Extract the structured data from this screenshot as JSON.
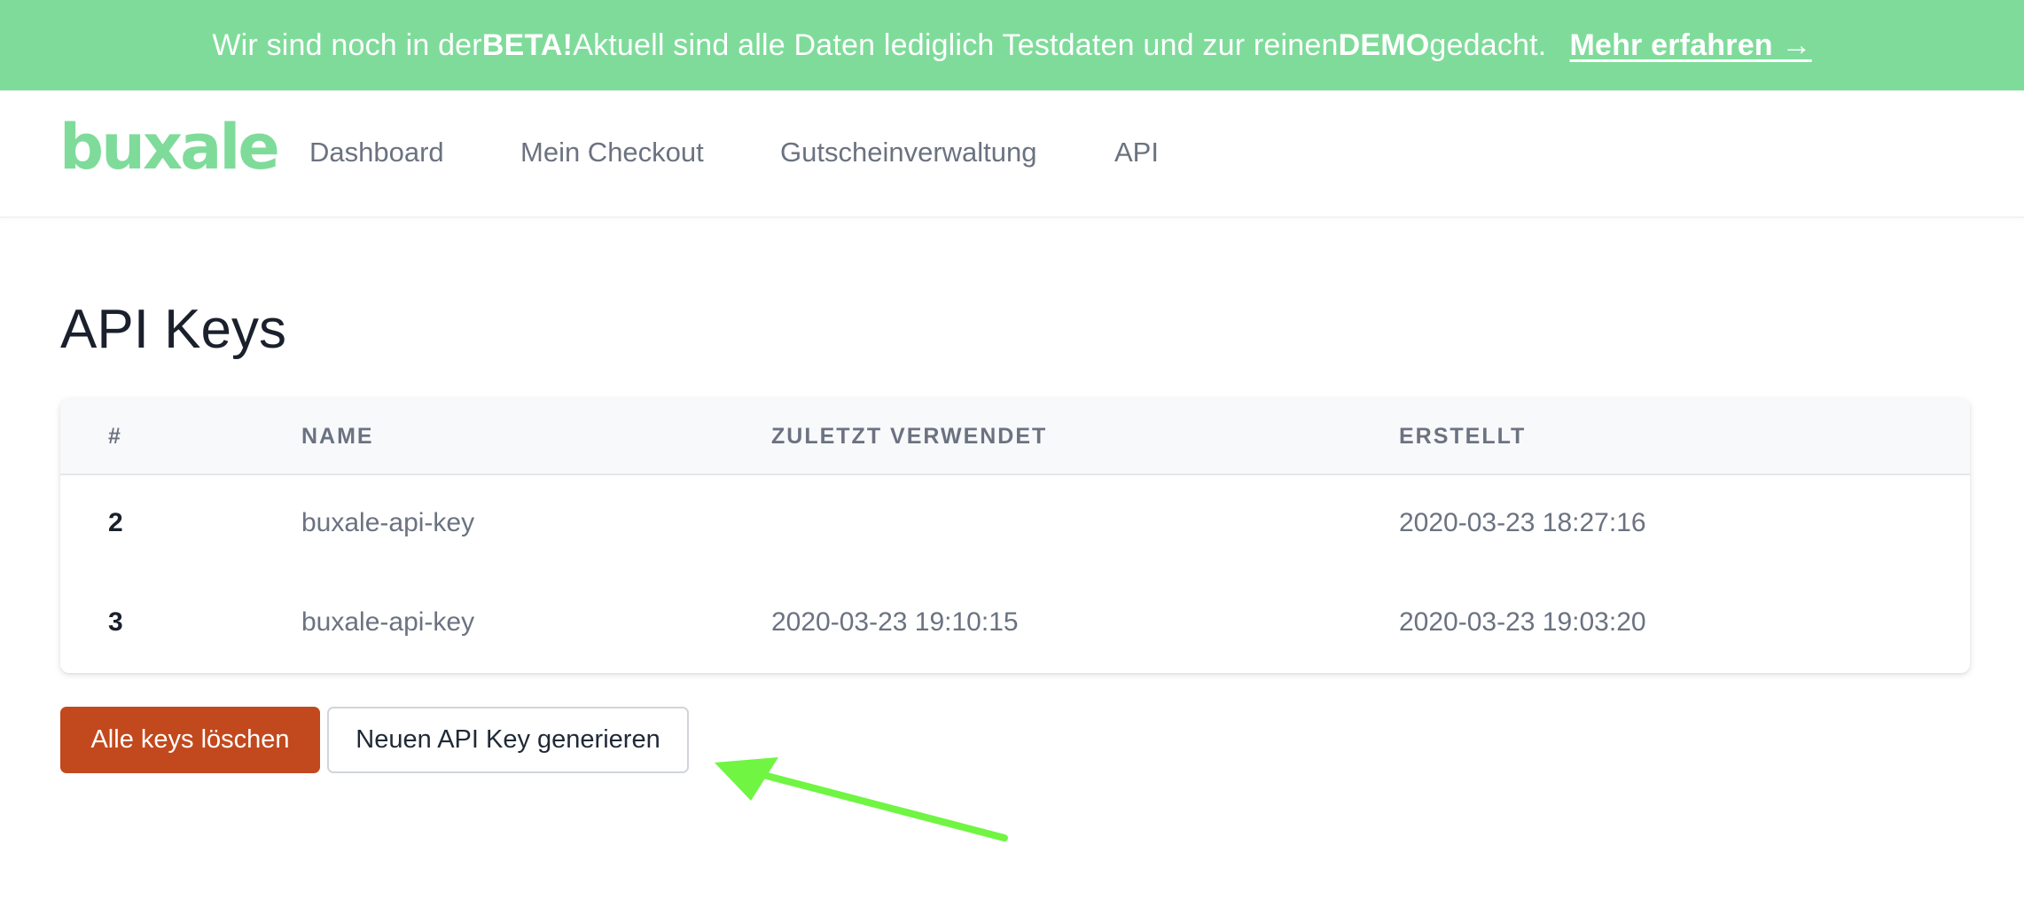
{
  "banner": {
    "text_1": "Wir sind noch in der ",
    "bold_1": "BETA!",
    "text_2": " Aktuell sind alle Daten lediglich Testdaten und zur reinen ",
    "bold_2": "DEMO",
    "text_3": " gedacht.",
    "link": "Mehr erfahren →",
    "color": "#7fdb9a"
  },
  "nav": {
    "logo": "buxale",
    "items": [
      "Dashboard",
      "Mein Checkout",
      "Gutscheinverwaltung",
      "API"
    ]
  },
  "page": {
    "title": "API Keys"
  },
  "table": {
    "headers": [
      "#",
      "NAME",
      "ZULETZT VERWENDET",
      "ERSTELLT"
    ],
    "rows": [
      {
        "id": "2",
        "name": "buxale-api-key",
        "last_used": "",
        "created": "2020-03-23 18:27:16"
      },
      {
        "id": "3",
        "name": "buxale-api-key",
        "last_used": "2020-03-23 19:10:15",
        "created": "2020-03-23 19:03:20"
      }
    ]
  },
  "actions": {
    "delete_all": "Alle keys löschen",
    "generate": "Neuen API Key generieren",
    "danger_color": "#c2491d"
  },
  "annotation": {
    "arrow_icon": "arrow-pointing-to-generate-button",
    "arrow_color": "#6ff542"
  }
}
